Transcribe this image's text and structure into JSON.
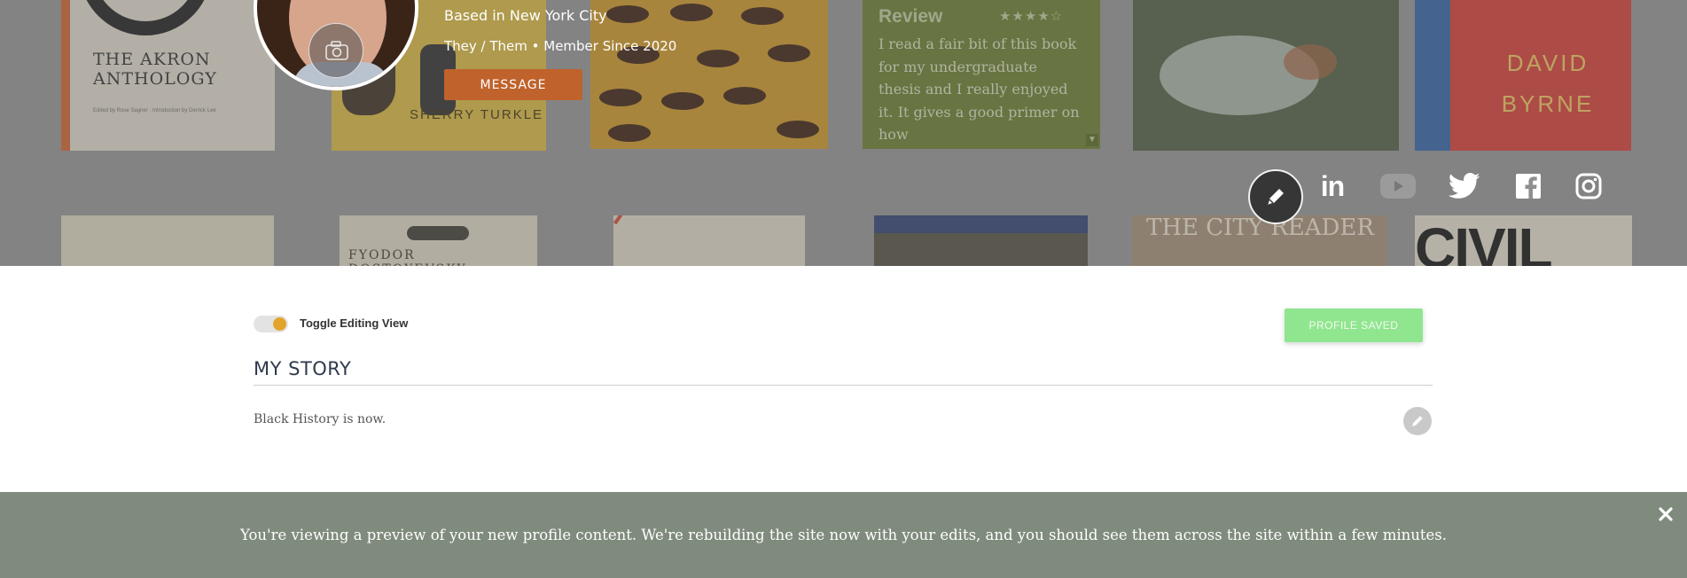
{
  "profile": {
    "location": "Based in New York City",
    "meta": "They / Them • Member Since 2020",
    "message_label": "MESSAGE"
  },
  "shelf": {
    "book1_title": "THE AKRON ANTHOLOGY",
    "book1_sub": "Edited by Rose Sagner · Introduction by Derrick Lee",
    "book2_author": "SHERRY TURKLE",
    "book6_author": "DAVID BYRNE",
    "book8_author": "FYODOR DOSTOYEVSKY",
    "book11_title": "THE CITY READER",
    "book12_title": "CIVIL",
    "review_title": "Review",
    "review_stars": "★★★★☆",
    "review_text": "I read a fair bit of this book for my undergraduate thesis and I really enjoyed it. It gives a good primer on how"
  },
  "social": {
    "icons": [
      "edit-icon",
      "linkedin-icon",
      "youtube-icon",
      "twitter-icon",
      "facebook-icon",
      "instagram-icon"
    ],
    "linkedin_glyph": "in"
  },
  "editing": {
    "toggle_label": "Toggle Editing View",
    "toggle_on": true,
    "saved_label": "PROFILE SAVED"
  },
  "story": {
    "title": "MY STORY",
    "body": "Black History is now."
  },
  "banner": {
    "text": "You're viewing a preview of your new profile content. We're rebuilding the site now with your edits, and you should see them across the site within a few minutes."
  },
  "colors": {
    "accent": "#c0622c",
    "toggle_knob": "#e3a42c",
    "saved": "#90e68f",
    "banner_bg": "#7f8b7c",
    "heading": "#2f3a4c"
  }
}
